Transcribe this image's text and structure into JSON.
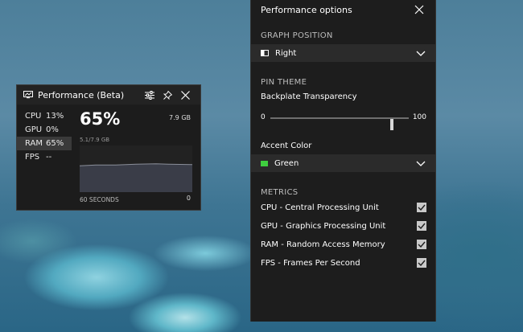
{
  "widget": {
    "title": "Performance (Beta)",
    "stats": [
      {
        "name": "CPU",
        "value": "13%"
      },
      {
        "name": "GPU",
        "value": "0%"
      },
      {
        "name": "RAM",
        "value": "65%"
      },
      {
        "name": "FPS",
        "value": "--"
      }
    ],
    "active_metric": "RAM",
    "big_value": "65%",
    "total": "7.9 GB",
    "used": "5.1/7.9 GB",
    "axis_left": "60 SECONDS",
    "axis_right": "0",
    "graph_fill_level": 0.65
  },
  "options": {
    "title": "Performance options",
    "graph_position": {
      "label": "GRAPH POSITION",
      "value": "Right"
    },
    "pin_theme": {
      "label": "PIN THEME",
      "transparency_label": "Backplate Transparency",
      "min": "0",
      "max": "100",
      "value": 88
    },
    "accent": {
      "label": "Accent Color",
      "value": "Green",
      "color": "#3fcf3f"
    },
    "metrics": {
      "label": "METRICS",
      "items": [
        {
          "label": "CPU - Central Processing Unit",
          "checked": true
        },
        {
          "label": "GPU - Graphics Processing Unit",
          "checked": true
        },
        {
          "label": "RAM - Random Access Memory",
          "checked": true
        },
        {
          "label": "FPS - Frames Per Second",
          "checked": true
        }
      ]
    }
  }
}
